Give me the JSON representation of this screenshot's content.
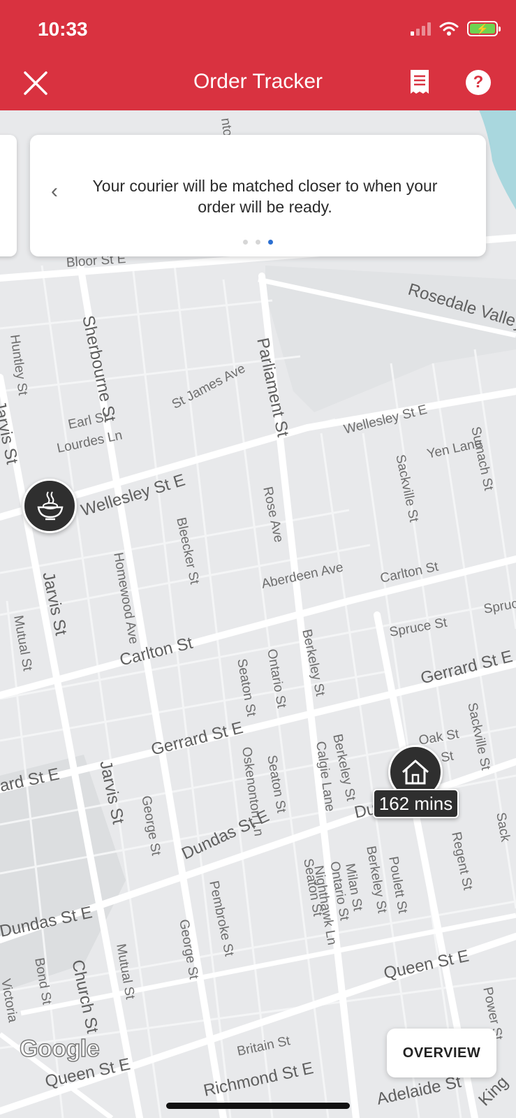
{
  "status_bar": {
    "time": "10:33"
  },
  "app_bar": {
    "title": "Order Tracker",
    "close_icon": "close-icon",
    "receipt_icon": "receipt-icon",
    "help_icon": "help-icon",
    "help_glyph": "?"
  },
  "info_card": {
    "message": "Your courier will be matched closer to when your order will be ready.",
    "pages_total": 3,
    "active_page": 3
  },
  "map": {
    "streets": [
      "Bloor St E",
      "Rosedale Valley",
      "Huntley St",
      "Sherbourne St",
      "Parliament St",
      "St James Ave",
      "Wellesley St E",
      "Jarvis St",
      "Earl St",
      "Lourdes Ln",
      "Yen Lane",
      "Sumach St",
      "Sackville St",
      "Rose Ave",
      "Bleecker St",
      "Homewood Ave",
      "Mutual St",
      "Aberdeen Ave",
      "Carlton St",
      "Spruce St",
      "Spruc",
      "Berkeley St",
      "Ontario St",
      "Seaton St",
      "Gerrard St E",
      "Oak St",
      "Oskenonton Ln",
      "Calgie Lane",
      "Dundas St E",
      "George St",
      "Regent St",
      "Pembroke St",
      "Milan St",
      "Nighthawk Ln",
      "Poulett St",
      "Queen St E",
      "Bond St",
      "Church St",
      "Victoria",
      "Britain St",
      "Richmond St E",
      "Adelaide St",
      "Power St",
      "King",
      "ard St E",
      "Dund",
      "nton",
      "le St",
      "Sack"
    ],
    "eta_label": "162 mins",
    "attribution": "Google"
  },
  "overview_button": {
    "label": "OVERVIEW"
  },
  "colors": {
    "brand_red": "#d93240",
    "active_dot": "#2b6fd1",
    "marker": "#2f2f2f"
  }
}
